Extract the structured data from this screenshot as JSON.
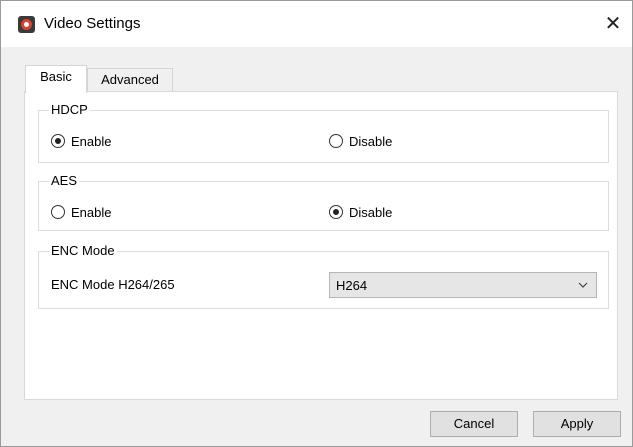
{
  "window": {
    "title": "Video Settings",
    "icon": "app-logo-icon",
    "close_glyph": "✕"
  },
  "tabs": [
    {
      "label": "Basic",
      "selected": true
    },
    {
      "label": "Advanced",
      "selected": false
    }
  ],
  "hdcp": {
    "group_label": "HDCP",
    "options": [
      {
        "label": "Enable",
        "checked": true
      },
      {
        "label": "Disable",
        "checked": false
      }
    ]
  },
  "aes": {
    "group_label": "AES",
    "options": [
      {
        "label": "Enable",
        "checked": false
      },
      {
        "label": "Disable",
        "checked": true
      }
    ]
  },
  "enc": {
    "group_label": "ENC Mode",
    "field_label": "ENC Mode H264/265",
    "selected_value": "H264"
  },
  "buttons": {
    "cancel": "Cancel",
    "apply": "Apply"
  }
}
